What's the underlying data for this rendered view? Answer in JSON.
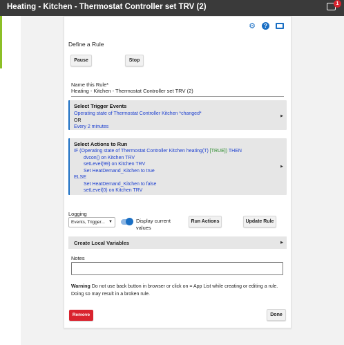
{
  "app": {
    "title": "Heating - Kitchen - Thermostat Controller set TRV (2)",
    "notification_count": "1"
  },
  "header_icons": [
    "gear-icon",
    "help-icon",
    "monitor-icon"
  ],
  "page": {
    "define_rule": "Define a Rule",
    "pause_label": "Pause",
    "stop_label": "Stop",
    "name_label": "Name this Rule*",
    "name_value": "Heating - Kitchen - Thermostat Controller set TRV (2)"
  },
  "triggers": {
    "title": "Select Trigger Events",
    "lines": [
      "Operating state of Thermostat Controller Kitchen *changed*",
      "OR",
      "Every 2 minutes"
    ]
  },
  "actions": {
    "title": "Select Actions to Run",
    "if_prefix": "IF (Operating state of Thermostat Controller Kitchen heating(T)",
    "if_true": "[TRUE])",
    "if_suffix": "THEN",
    "then_lines": [
      "dvcon() on Kitchen TRV",
      "setLevel(99) on Kitchen TRV",
      "Set HeatDemand_Kitchen to true"
    ],
    "else_label": "ELSE",
    "else_lines": [
      "Set HeatDemand_Kitchen to false",
      "setLevel(0) on Kitchen TRV"
    ]
  },
  "logging": {
    "label": "Logging",
    "selected": "Events, Trigger...",
    "display_current_line1": "Display current",
    "display_current_line2": "values",
    "display_current_on": true
  },
  "buttons": {
    "run_actions": "Run Actions",
    "update_rule": "Update Rule",
    "remove": "Remove",
    "done": "Done"
  },
  "local_vars": {
    "label": "Create Local Variables"
  },
  "notes": {
    "label": "Notes",
    "value": ""
  },
  "warning": {
    "bold": "Warning",
    "text": "Do not use back button in browser or click on = App List while creating or editing a rule. Doing so may result in a broken rule."
  },
  "colors": {
    "accent": "#1a6fc4",
    "remove": "#d9232e",
    "header": "#3a3a3a",
    "green_bar": "#8cbf26"
  }
}
